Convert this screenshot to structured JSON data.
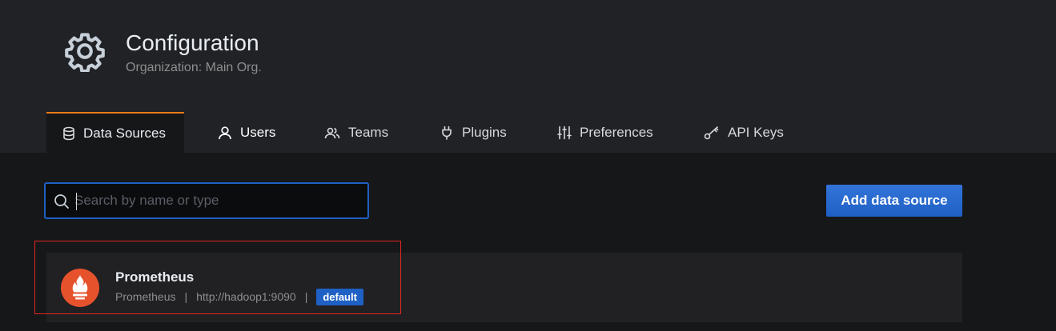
{
  "header": {
    "title": "Configuration",
    "subtitle": "Organization: Main Org.",
    "icon": "gear-icon"
  },
  "tabs": [
    {
      "label": "Data Sources",
      "icon": "database-icon",
      "active": true
    },
    {
      "label": "Users",
      "icon": "user-icon",
      "active": false
    },
    {
      "label": "Teams",
      "icon": "users-icon",
      "active": false
    },
    {
      "label": "Plugins",
      "icon": "plug-icon",
      "active": false
    },
    {
      "label": "Preferences",
      "icon": "sliders-icon",
      "active": false
    },
    {
      "label": "API Keys",
      "icon": "key-icon",
      "active": false
    }
  ],
  "search": {
    "placeholder": "Search by name or type",
    "value": ""
  },
  "add_button": {
    "label": "Add data source"
  },
  "datasources": [
    {
      "name": "Prometheus",
      "type": "Prometheus",
      "url": "http://hadoop1:9090",
      "badge": "default",
      "separator": "|",
      "logo": "prometheus-logo-icon"
    }
  ],
  "colors": {
    "accent_tab": "#eb7b18",
    "primary": "#1f60c4",
    "prometheus": "#e6522c",
    "highlight": "#e0261f"
  }
}
